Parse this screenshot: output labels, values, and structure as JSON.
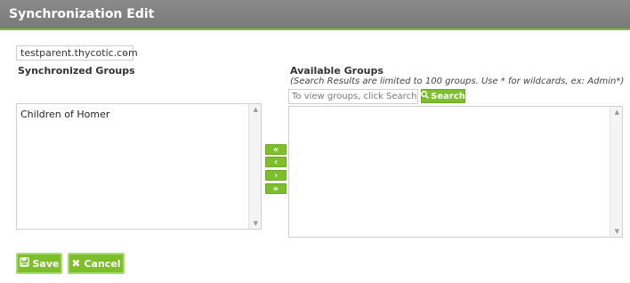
{
  "header": {
    "title": "Synchronization Edit"
  },
  "domain_select": {
    "value": "testparent.thycotic.com"
  },
  "synchronized": {
    "heading": "Synchronized Groups",
    "items": [
      "Children of Homer"
    ]
  },
  "available": {
    "heading": "Available Groups",
    "note": "(Search Results are limited to 100 groups. Use * for wildcards, ex: Admin*)",
    "search_placeholder": "To view groups, click Search",
    "search_label": "Search"
  },
  "move_buttons": {
    "all_left": "«",
    "left": "‹",
    "right": "›",
    "all_right": "»"
  },
  "actions": {
    "save_label": "Save",
    "cancel_label": "Cancel"
  },
  "colors": {
    "accent": "#7cbf2a",
    "header_bg": "#7e7e7e"
  }
}
